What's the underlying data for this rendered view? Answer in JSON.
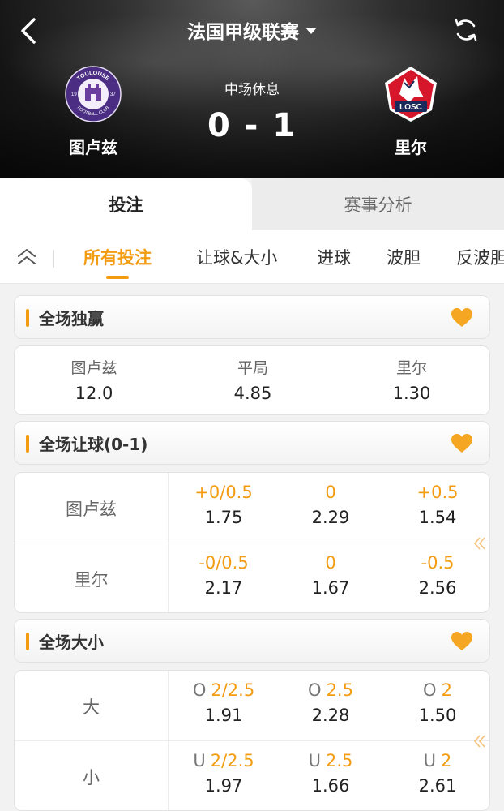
{
  "header": {
    "league": "法国甲级联赛",
    "status": "中场休息",
    "score": "0 - 1",
    "home_team": "图卢兹",
    "away_team": "里尔",
    "home_logo": {
      "top_text": "TOULOUSE",
      "bottom_text": "FOOTBALL CLUB",
      "left_year": "19",
      "right_year": "37"
    },
    "away_logo": {
      "text": "LOSC"
    }
  },
  "tabs": {
    "active": "投注",
    "inactive": "赛事分析"
  },
  "sub_tabs": [
    "所有投注",
    "让球&大小",
    "进球",
    "波胆",
    "反波胆"
  ],
  "sections": {
    "match_winner": {
      "title": "全场独赢",
      "cells": [
        {
          "label": "图卢兹",
          "odds": "12.0"
        },
        {
          "label": "平局",
          "odds": "4.85"
        },
        {
          "label": "里尔",
          "odds": "1.30"
        }
      ]
    },
    "handicap": {
      "title": "全场让球(0-1)",
      "rows": [
        {
          "team": "图卢兹",
          "options": [
            {
              "line": "+0/0.5",
              "price": "1.75"
            },
            {
              "line": "0",
              "price": "2.29"
            },
            {
              "line": "+0.5",
              "price": "1.54"
            }
          ]
        },
        {
          "team": "里尔",
          "options": [
            {
              "line": "-0/0.5",
              "price": "2.17"
            },
            {
              "line": "0",
              "price": "1.67"
            },
            {
              "line": "-0.5",
              "price": "2.56"
            }
          ]
        }
      ]
    },
    "over_under": {
      "title": "全场大小",
      "rows": [
        {
          "label": "大",
          "options": [
            {
              "prefix": "O",
              "line": "2/2.5",
              "price": "1.91"
            },
            {
              "prefix": "O",
              "line": "2.5",
              "price": "2.28"
            },
            {
              "prefix": "O",
              "line": "2",
              "price": "1.50"
            }
          ]
        },
        {
          "label": "小",
          "options": [
            {
              "prefix": "U",
              "line": "2/2.5",
              "price": "1.97"
            },
            {
              "prefix": "U",
              "line": "2.5",
              "price": "1.66"
            },
            {
              "prefix": "U",
              "line": "2",
              "price": "2.61"
            }
          ]
        }
      ]
    }
  },
  "colors": {
    "accent": "#f39c12",
    "home_logo_purple": "#4b2e83",
    "away_logo_red": "#d6172b"
  },
  "icons": [
    "back-arrow-icon",
    "refresh-icon",
    "caret-down-icon",
    "collapse-up-icon",
    "heart-icon",
    "double-chevron-left-icon"
  ]
}
